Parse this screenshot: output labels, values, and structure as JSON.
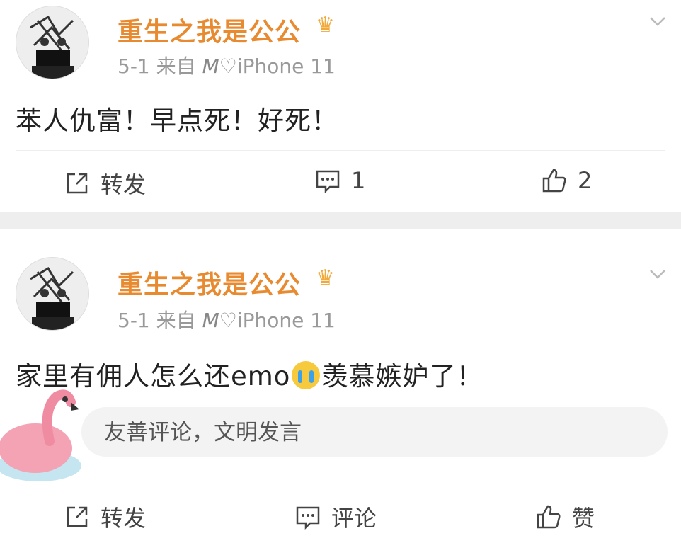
{
  "posts": [
    {
      "username": "重生之我是公公",
      "date": "5-1",
      "source_prefix": "来自",
      "source_brand": "M♡",
      "source_device": "iPhone 11",
      "content": "苯人仇富！早点死！好死！",
      "actions": {
        "repost_label": "转发",
        "comment_count": "1",
        "like_count": "2"
      }
    },
    {
      "username": "重生之我是公公",
      "date": "5-1",
      "source_prefix": "来自",
      "source_brand": "M♡",
      "source_device": "iPhone 11",
      "content_before": "家里有佣人怎么还emo",
      "content_after": "羡慕嫉妒了！",
      "comment_placeholder": "友善评论，文明发言",
      "actions": {
        "repost_label": "转发",
        "comment_label": "评论",
        "like_label": "赞"
      }
    }
  ],
  "icons": {
    "crown": "crown-icon",
    "chevron": "chevron-down-icon",
    "repost": "repost-icon",
    "comment": "comment-icon",
    "like": "thumbs-up-icon",
    "emoji": "crying-face-icon"
  },
  "colors": {
    "username": "#e88a2f",
    "meta": "#999999",
    "separator": "#eeeeee"
  }
}
